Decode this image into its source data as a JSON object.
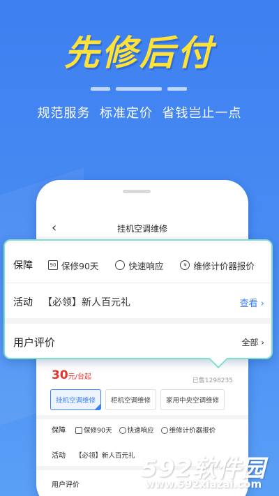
{
  "hero": {
    "headline": "先修后付",
    "tagline": "规范服务  标准定价  省钱岂止一点"
  },
  "phone": {
    "nav_title": "挂机空调维修",
    "price": "30",
    "price_unit": "元/台起",
    "sold": "已售1298235",
    "chips": [
      "挂机空调维修",
      "柜机空调维修",
      "家用中央空调维修"
    ],
    "guarantee_label": "保障",
    "features": [
      "保修90天",
      "快速响应",
      "维修计价器报价"
    ],
    "activity_label": "活动",
    "activity_text": "【必领】新人百元礼",
    "reviews_label": "用户评价"
  },
  "popup": {
    "guarantee_label": "保障",
    "features": [
      "保修90天",
      "快速响应",
      "维修计价器报价"
    ],
    "calendar_badge": "90",
    "yen_badge": "¥",
    "activity_label": "活动",
    "activity_text": "【必领】新人百元礼",
    "activity_link": "查看",
    "reviews_label": "用户评价",
    "reviews_link": "全部"
  },
  "watermark": {
    "logo_num": "592",
    "logo_text": "软件园",
    "url": "www.592xiazai.com"
  },
  "colors": {
    "background": "#3f86f0",
    "headline": "#ffe235",
    "accent": "#3a7ff0",
    "price": "#e8312d",
    "popup_border": "#7ee0c8"
  }
}
